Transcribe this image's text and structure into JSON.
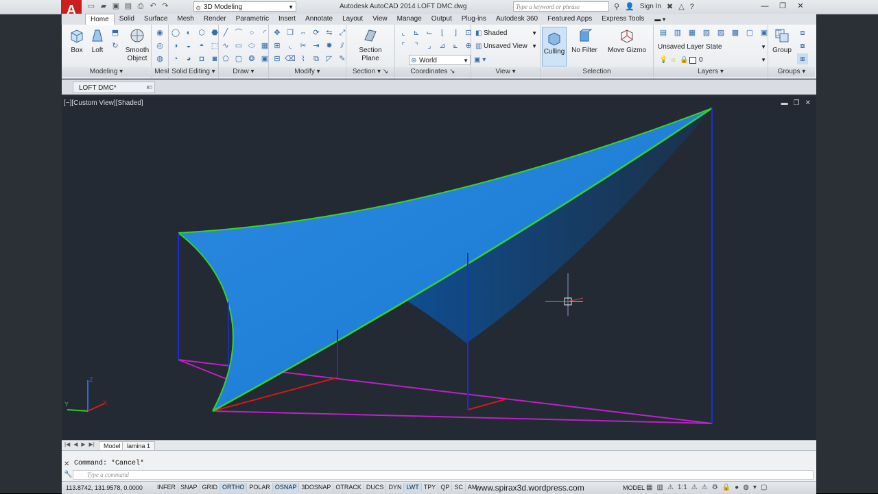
{
  "app": {
    "logo": "A",
    "title": "Autodesk AutoCAD 2014    LOFT DMC.dwg",
    "workspace": "3D Modeling",
    "search_placeholder": "Type a keyword or phrase",
    "sign_in": "Sign In"
  },
  "tabs": [
    "Home",
    "Solid",
    "Surface",
    "Mesh",
    "Render",
    "Parametric",
    "Insert",
    "Annotate",
    "Layout",
    "View",
    "Manage",
    "Output",
    "Plug-ins",
    "Autodesk 360",
    "Featured Apps",
    "Express Tools"
  ],
  "ribbon": {
    "box": "Box",
    "loft": "Loft",
    "smooth_object_1": "Smooth",
    "smooth_object_2": "Object",
    "section_plane_1": "Section",
    "section_plane_2": "Plane",
    "visual_style": "Shaded",
    "view_name": "Unsaved View",
    "ucs": "World",
    "culling": "Culling",
    "no_filter": "No Filter",
    "move_gizmo": "Move Gizmo",
    "layer_state": "Unsaved Layer State",
    "layer_name": "0",
    "group": "Group",
    "panels": {
      "modeling": "Modeling",
      "mesh": "Mesh",
      "solid_editing": "Solid Editing",
      "draw": "Draw",
      "modify": "Modify",
      "section": "Section",
      "coordinates": "Coordinates",
      "view": "View",
      "selection": "Selection",
      "layers": "Layers",
      "groups": "Groups"
    }
  },
  "file_tab": "LOFT DMC*",
  "viewport": {
    "label": "[−][Custom View][Shaded]"
  },
  "layout_tabs": [
    "Model",
    "lamina 1"
  ],
  "command": {
    "history": "Command: *Cancel*",
    "placeholder": "Type a command"
  },
  "status": {
    "coords": "113.8742, 131.9578, 0.0000",
    "toggles": [
      {
        "label": "INFER",
        "on": false
      },
      {
        "label": "SNAP",
        "on": false
      },
      {
        "label": "GRID",
        "on": false
      },
      {
        "label": "ORTHO",
        "on": true
      },
      {
        "label": "POLAR",
        "on": false
      },
      {
        "label": "OSNAP",
        "on": true
      },
      {
        "label": "3DOSNAP",
        "on": false
      },
      {
        "label": "OTRACK",
        "on": false
      },
      {
        "label": "DUCS",
        "on": false
      },
      {
        "label": "DYN",
        "on": false
      },
      {
        "label": "LWT",
        "on": true
      },
      {
        "label": "TPY",
        "on": false
      },
      {
        "label": "QP",
        "on": false
      },
      {
        "label": "SC",
        "on": false
      },
      {
        "label": "AM",
        "on": false
      }
    ],
    "watermark": "www.spirax3d.wordpress.com",
    "model": "MODEL",
    "scale": "1:1"
  },
  "colors": {
    "surface": "#1f7fd6",
    "edge": "#39d12d",
    "ground": "#c020c8",
    "red_line": "#d81818",
    "blue_line": "#1a2fd0",
    "viewport_bg": "#232a33"
  }
}
